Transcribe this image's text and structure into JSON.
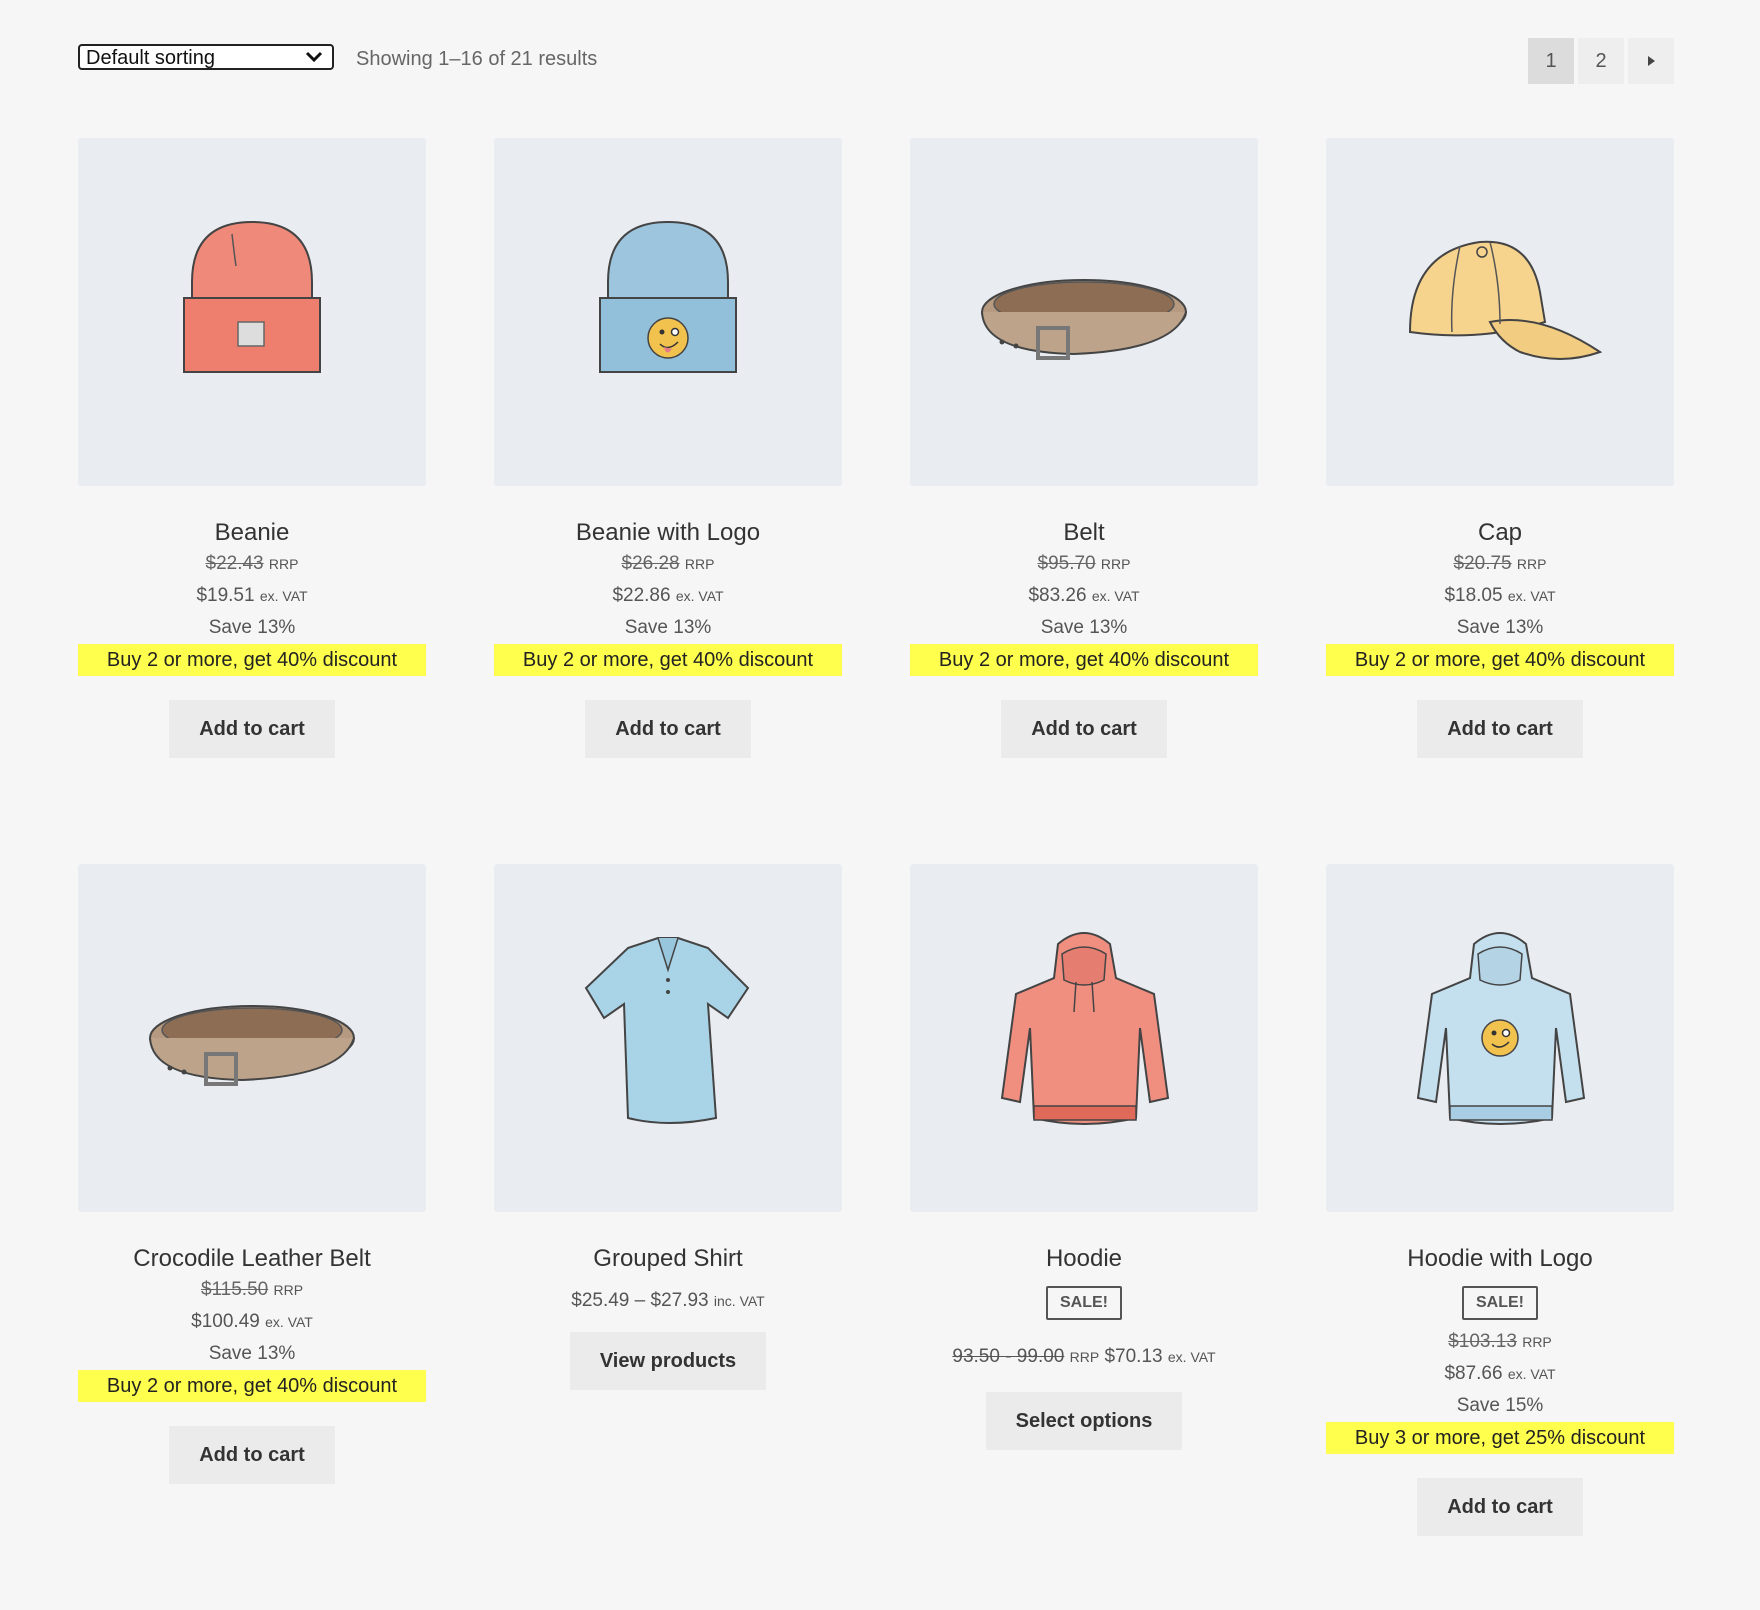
{
  "toolbar": {
    "sort_value": "Default sorting",
    "result_count": "Showing 1–16 of 21 results",
    "pages": [
      "1",
      "2"
    ],
    "current_page": "1"
  },
  "products": [
    {
      "title": "Beanie",
      "rrp": "$22.43",
      "rrp_suffix": "RRP",
      "price": "$19.51",
      "price_suffix": "ex. VAT",
      "save": "Save 13%",
      "promo": "Buy 2 or more, get 40% discount",
      "button": "Add to cart",
      "icon": "beanie-icon"
    },
    {
      "title": "Beanie with Logo",
      "rrp": "$26.28",
      "rrp_suffix": "RRP",
      "price": "$22.86",
      "price_suffix": "ex. VAT",
      "save": "Save 13%",
      "promo": "Buy 2 or more, get 40% discount",
      "button": "Add to cart",
      "icon": "beanie-logo-icon"
    },
    {
      "title": "Belt",
      "rrp": "$95.70",
      "rrp_suffix": "RRP",
      "price": "$83.26",
      "price_suffix": "ex. VAT",
      "save": "Save 13%",
      "promo": "Buy 2 or more, get 40% discount",
      "button": "Add to cart",
      "icon": "belt-icon"
    },
    {
      "title": "Cap",
      "rrp": "$20.75",
      "rrp_suffix": "RRP",
      "price": "$18.05",
      "price_suffix": "ex. VAT",
      "save": "Save 13%",
      "promo": "Buy 2 or more, get 40% discount",
      "button": "Add to cart",
      "icon": "cap-icon"
    },
    {
      "title": "Crocodile Leather Belt",
      "rrp": "$115.50",
      "rrp_suffix": "RRP",
      "price": "$100.49",
      "price_suffix": "ex. VAT",
      "save": "Save 13%",
      "promo": "Buy 2 or more, get 40% discount",
      "button": "Add to cart",
      "icon": "belt-icon"
    },
    {
      "title": "Grouped Shirt",
      "price_range": "$25.49 – $27.93",
      "price_suffix": "inc. VAT",
      "button": "View products",
      "icon": "polo-shirt-icon"
    },
    {
      "title": "Hoodie",
      "badge": "SALE!",
      "rrp": "93.50 - 99.00",
      "rrp_suffix": "RRP",
      "price": "$70.13",
      "price_suffix": "ex. VAT",
      "button": "Select options",
      "icon": "hoodie-icon"
    },
    {
      "title": "Hoodie with Logo",
      "badge": "SALE!",
      "rrp": "$103.13",
      "rrp_suffix": "RRP",
      "price": "$87.66",
      "price_suffix": "ex. VAT",
      "save": "Save 15%",
      "promo": "Buy 3 or more, get 25% discount",
      "button": "Add to cart",
      "icon": "hoodie-logo-icon"
    }
  ],
  "colors": {
    "background": "#f6f6f6",
    "thumb_bg": "#e9edf1",
    "promo_bg": "#ffff4d",
    "button_bg": "#ebebeb"
  }
}
